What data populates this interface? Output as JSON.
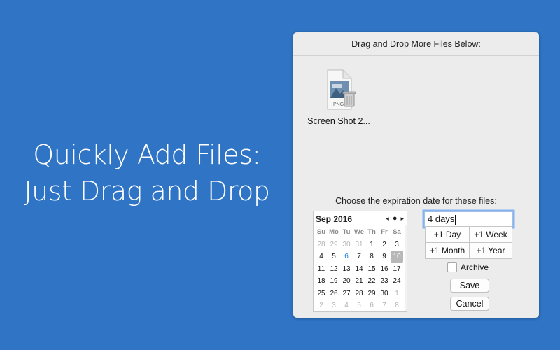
{
  "promo": {
    "line1": "Quickly Add Files:",
    "line2": "Just Drag and Drop"
  },
  "drop_zone": {
    "header": "Drag and Drop More Files Below:",
    "files": [
      {
        "name": "Screen Shot 2...",
        "type_badge": "PNG",
        "icon": "png-file-icon"
      }
    ]
  },
  "expiration": {
    "label": "Choose the expiration date for these files:",
    "calendar": {
      "month_label": "Sep 2016",
      "nav": {
        "prev": "◂",
        "today": "●",
        "next": "▸"
      },
      "weekdays": [
        "Su",
        "Mo",
        "Tu",
        "We",
        "Th",
        "Fr",
        "Sa"
      ],
      "weeks": [
        [
          "28",
          "29",
          "30",
          "31",
          "1",
          "2",
          "3"
        ],
        [
          "4",
          "5",
          "6",
          "7",
          "8",
          "9",
          "10"
        ],
        [
          "11",
          "12",
          "13",
          "14",
          "15",
          "16",
          "17"
        ],
        [
          "18",
          "19",
          "20",
          "21",
          "22",
          "23",
          "24"
        ],
        [
          "25",
          "26",
          "27",
          "28",
          "29",
          "30",
          "1"
        ],
        [
          "2",
          "3",
          "4",
          "5",
          "6",
          "7",
          "8"
        ]
      ],
      "today": "6",
      "selected": "10"
    },
    "duration_value": "4 days",
    "quick_buttons": [
      "+1 Day",
      "+1 Week",
      "+1 Month",
      "+1 Year"
    ],
    "archive_label": "Archive",
    "archive_checked": false,
    "save_label": "Save",
    "cancel_label": "Cancel"
  },
  "colors": {
    "background": "#2f74c5",
    "panel": "#ececec",
    "today_accent": "#1a7fe0",
    "focus_ring": "#84b4f0"
  }
}
